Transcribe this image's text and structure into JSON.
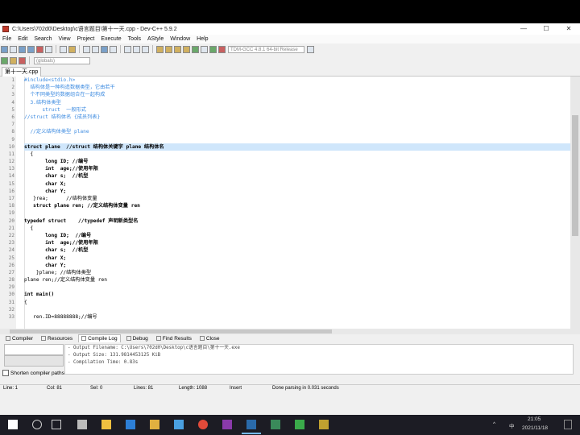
{
  "window": {
    "title": "C:\\Users\\702d0\\Desktop\\c语言题目\\第十一天.cpp - Dev-C++ 5.9.2",
    "minimize": "—",
    "maximize": "☐",
    "close": "✕"
  },
  "menu": [
    "File",
    "Edit",
    "Search",
    "View",
    "Project",
    "Execute",
    "Tools",
    "AStyle",
    "Window",
    "Help"
  ],
  "toolbar": {
    "compiler_combo": "TDM-GCC 4.8.1 64-bit Release",
    "globals_combo": "(globals)"
  },
  "file_tab": "第十一天.cpp",
  "editor": {
    "lines": [
      {
        "n": "1",
        "t": "#include<stdio.h>",
        "k": "cm"
      },
      {
        "n": "2",
        "t": "  结构体是一种构造数据类型，它由若干",
        "k": "cm"
      },
      {
        "n": "3",
        "t": "  个不同类型的数据组合在一起构成",
        "k": "cm"
      },
      {
        "n": "4",
        "t": "  3.结构体类型",
        "k": "cm"
      },
      {
        "n": "5",
        "t": "      struct  一般形式",
        "k": "cm"
      },
      {
        "n": "6",
        "t": "//struct 结构体名 {成员列表}",
        "k": "cm"
      },
      {
        "n": "7",
        "t": "",
        "k": ""
      },
      {
        "n": "8",
        "t": "  //定义结构体类型 plane",
        "k": "cm"
      },
      {
        "n": "9",
        "t": "",
        "k": ""
      },
      {
        "n": "10",
        "t": "struct plane  //struct 结构体关键字 plane 结构体名",
        "k": "kw"
      },
      {
        "n": "11",
        "t": "  {",
        "k": ""
      },
      {
        "n": "12",
        "t": "       long ID; //编号",
        "k": "kw"
      },
      {
        "n": "13",
        "t": "       int  age;//使用年限",
        "k": "kw"
      },
      {
        "n": "14",
        "t": "       char s;  //机型",
        "k": "kw"
      },
      {
        "n": "15",
        "t": "       char X;",
        "k": "kw"
      },
      {
        "n": "16",
        "t": "       char Y;",
        "k": "kw"
      },
      {
        "n": "17",
        "t": "   }rea;      //结构体变量",
        "k": ""
      },
      {
        "n": "18",
        "t": "   struct plane ren; //定义结构体变量 ren",
        "k": "kw"
      },
      {
        "n": "19",
        "t": "",
        "k": ""
      },
      {
        "n": "20",
        "t": "typedef struct    //typedef 声明新类型名",
        "k": "kw"
      },
      {
        "n": "21",
        "t": "  {",
        "k": ""
      },
      {
        "n": "22",
        "t": "       long ID;  //编号",
        "k": "kw"
      },
      {
        "n": "23",
        "t": "       int  age;//使用年限",
        "k": "kw"
      },
      {
        "n": "24",
        "t": "       char s;  //机型",
        "k": "kw"
      },
      {
        "n": "25",
        "t": "       char X;",
        "k": "kw"
      },
      {
        "n": "26",
        "t": "       char Y;",
        "k": "kw"
      },
      {
        "n": "27",
        "t": "    }plane; //结构体类型",
        "k": ""
      },
      {
        "n": "28",
        "t": "plane ren;//定义结构体变量 ren",
        "k": ""
      },
      {
        "n": "29",
        "t": "",
        "k": ""
      },
      {
        "n": "30",
        "t": "int main()",
        "k": "kw"
      },
      {
        "n": "31",
        "t": "{",
        "k": ""
      },
      {
        "n": "32",
        "t": "",
        "k": ""
      },
      {
        "n": "33",
        "t": "   ren.ID=88888888;//编号",
        "k": ""
      }
    ]
  },
  "bottom_tabs": [
    "Compiler",
    "Resources",
    "Compile Log",
    "Debug",
    "Find Results",
    "Close"
  ],
  "log": [
    "- Output Filename: C:\\Users\\702d0\\Desktop\\c语言题目\\第十一天.exe",
    "- Output Size: 131.9814453125 KiB",
    "- Compilation Time: 0.83s"
  ],
  "shorten_label": "Shorten compiler paths",
  "status": {
    "line": "Line:  1",
    "col": "Col:  81",
    "sel": "Sel:  0",
    "lines": "Lines:  81",
    "length": "Length:  1088",
    "insert": "Insert",
    "parse": "Done parsing in 0.031 seconds"
  },
  "taskbar": {
    "time": "21:05",
    "date": "2021/11/18",
    "ime": "中"
  }
}
